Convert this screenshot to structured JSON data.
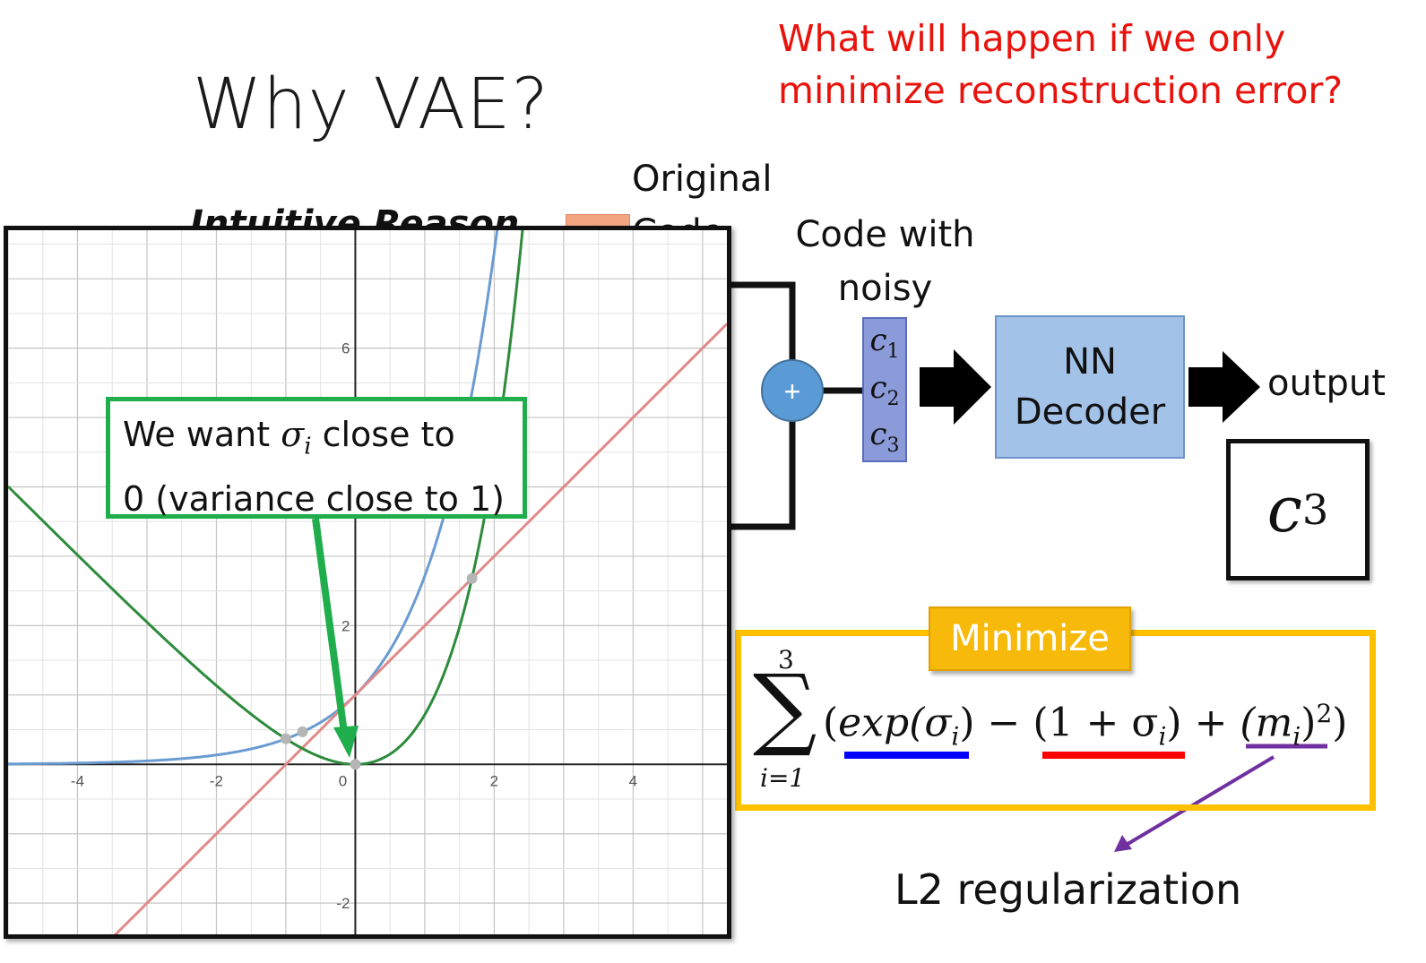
{
  "slide": {
    "title": "Why VAE?",
    "question_line1": "What will happen if we only",
    "question_line2": "minimize reconstruction error?",
    "intuitive_reason": "Intuitive Reason",
    "original_code_line1": "Original",
    "original_code_line2": "Code",
    "noisy_code_line1": "Code with",
    "noisy_code_line2": "noisy",
    "plus_symbol": "+",
    "code_items": [
      {
        "var": "c",
        "sub": "1"
      },
      {
        "var": "c",
        "sub": "2"
      },
      {
        "var": "c",
        "sub": "3"
      }
    ],
    "decoder_line1": "NN",
    "decoder_line2": "Decoder",
    "output_label": "output",
    "output_code": {
      "var": "c",
      "sub": "3"
    },
    "minimize_label": "Minimize",
    "formula": {
      "sum_top": "3",
      "sum_symbol": "∑",
      "sum_bottom": "i=1",
      "open": "(",
      "exp_part": "exp(σ",
      "exp_sub": "i",
      "exp_close": ")",
      "minus": " − ",
      "lin_part": "(1 + σ",
      "lin_sub": "i",
      "lin_close": ")",
      "plus": " + ",
      "sq_open": "(m",
      "sq_sub": "i",
      "sq_close": ")",
      "sq_sup": "2",
      "close": ")"
    },
    "l2_label": "L2 regularization",
    "callout_prefix": "We want ",
    "callout_sigma": "σ",
    "callout_sub": "i",
    "callout_suffix": " close to",
    "callout_line2": "0 (variance close to 1)",
    "colors": {
      "question": "#e8130c",
      "exp_curve": "#6a9bd1",
      "linear_curve": "#e08a8a",
      "difference_curve": "#2e8b3c",
      "callout_border": "#1fae4b",
      "minimize_frame": "#ffc000",
      "underline_exp": "#0000ff",
      "underline_lin": "#ff0000",
      "underline_sq": "#7030a0"
    }
  },
  "chart_data": {
    "type": "line",
    "series": [
      {
        "expr": "exp(x)"
      },
      {
        "expr": "1 + x"
      },
      {
        "expr": "exp(x) - (1 + x)"
      }
    ],
    "points": [
      {
        "x": -0.76,
        "y": 0.47
      },
      {
        "x": -1.0,
        "y": 0.37
      },
      {
        "x": 0,
        "y": 0
      },
      {
        "x": 1.68,
        "y": 2.68
      }
    ],
    "x_ticks": [
      "-4",
      "-2",
      "0",
      "2",
      "4"
    ],
    "y_ticks": [
      "6",
      "2",
      "-2"
    ],
    "xlim": [
      -5,
      5.35
    ],
    "ylim": [
      -2.45,
      7.7
    ],
    "grid": true
  }
}
